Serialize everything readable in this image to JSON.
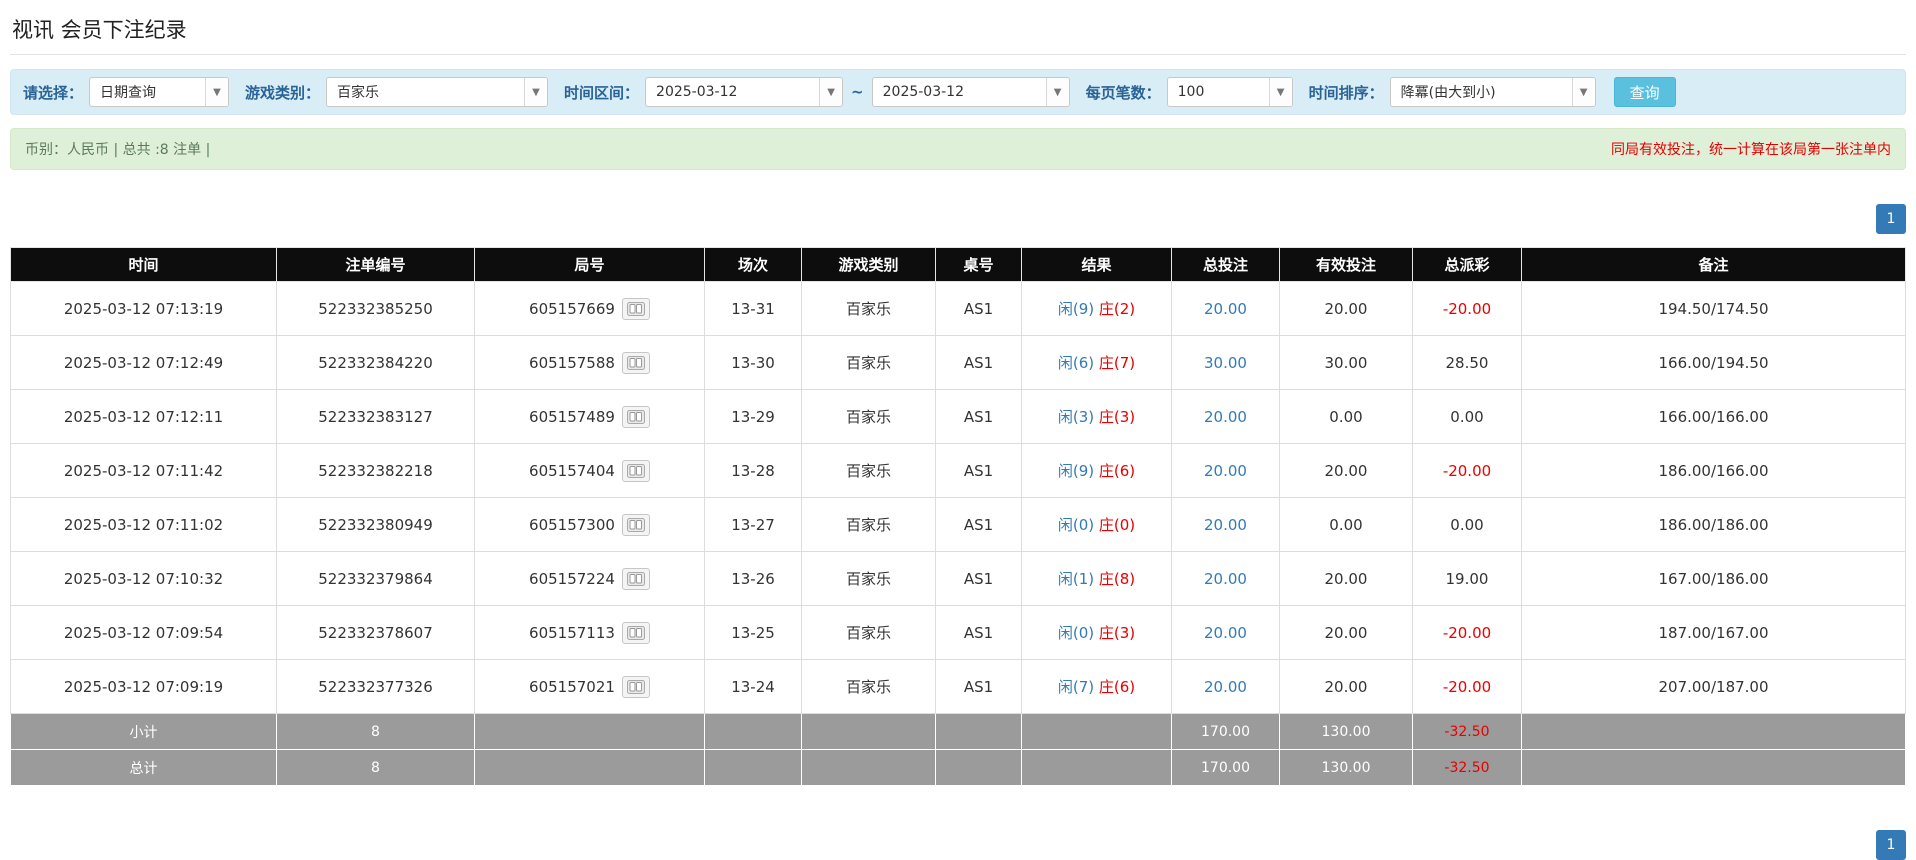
{
  "page": {
    "title": "视讯 会员下注纪录"
  },
  "colors": {
    "accent_blue": "#337ab7",
    "danger_red": "#e60000",
    "filter_bar_bg": "#d9edf7",
    "summary_bar_bg": "#dff0d8",
    "table_header_bg": "#0d0d0d",
    "summary_row_bg": "#9b9b9b",
    "search_button_bg": "#5bc0de"
  },
  "filters": {
    "select_label": "请选择：",
    "select_value": "日期查询",
    "game_type_label": "游戏类别：",
    "game_type_value": "百家乐",
    "date_range_label": "时间区间：",
    "date_from": "2025-03-12",
    "tilde": "~",
    "date_to": "2025-03-12",
    "page_size_label": "每页笔数：",
    "page_size_value": "100",
    "sort_label": "时间排序：",
    "sort_value": "降冪(由大到小)",
    "search_button": "查询",
    "caret": "▼"
  },
  "summary": {
    "left": "币别：人民币 | 总共 :8 注单 |",
    "right": "同局有效投注，统一计算在该局第一张注单内"
  },
  "pagination": {
    "current_page": "1"
  },
  "table": {
    "headers": [
      "时间",
      "注单编号",
      "局号",
      "场次",
      "游戏类别",
      "桌号",
      "结果",
      "总投注",
      "有效投注",
      "总派彩",
      "备注"
    ],
    "rows": [
      {
        "time": "2025-03-12 07:13:19",
        "bet_id": "522332385250",
        "round": "605157669",
        "session": "13-31",
        "game": "百家乐",
        "table_no": "AS1",
        "result_player": "闲(9)",
        "result_banker": "庄(2)",
        "total_bet": "20.00",
        "valid_bet": "20.00",
        "payout": "-20.00",
        "note": "194.50/174.50"
      },
      {
        "time": "2025-03-12 07:12:49",
        "bet_id": "522332384220",
        "round": "605157588",
        "session": "13-30",
        "game": "百家乐",
        "table_no": "AS1",
        "result_player": "闲(6)",
        "result_banker": "庄(7)",
        "total_bet": "30.00",
        "valid_bet": "30.00",
        "payout": "28.50",
        "note": "166.00/194.50"
      },
      {
        "time": "2025-03-12 07:12:11",
        "bet_id": "522332383127",
        "round": "605157489",
        "session": "13-29",
        "game": "百家乐",
        "table_no": "AS1",
        "result_player": "闲(3)",
        "result_banker": "庄(3)",
        "total_bet": "20.00",
        "valid_bet": "0.00",
        "payout": "0.00",
        "note": "166.00/166.00"
      },
      {
        "time": "2025-03-12 07:11:42",
        "bet_id": "522332382218",
        "round": "605157404",
        "session": "13-28",
        "game": "百家乐",
        "table_no": "AS1",
        "result_player": "闲(9)",
        "result_banker": "庄(6)",
        "total_bet": "20.00",
        "valid_bet": "20.00",
        "payout": "-20.00",
        "note": "186.00/166.00"
      },
      {
        "time": "2025-03-12 07:11:02",
        "bet_id": "522332380949",
        "round": "605157300",
        "session": "13-27",
        "game": "百家乐",
        "table_no": "AS1",
        "result_player": "闲(0)",
        "result_banker": "庄(0)",
        "total_bet": "20.00",
        "valid_bet": "0.00",
        "payout": "0.00",
        "note": "186.00/186.00"
      },
      {
        "time": "2025-03-12 07:10:32",
        "bet_id": "522332379864",
        "round": "605157224",
        "session": "13-26",
        "game": "百家乐",
        "table_no": "AS1",
        "result_player": "闲(1)",
        "result_banker": "庄(8)",
        "total_bet": "20.00",
        "valid_bet": "20.00",
        "payout": "19.00",
        "note": "167.00/186.00"
      },
      {
        "time": "2025-03-12 07:09:54",
        "bet_id": "522332378607",
        "round": "605157113",
        "session": "13-25",
        "game": "百家乐",
        "table_no": "AS1",
        "result_player": "闲(0)",
        "result_banker": "庄(3)",
        "total_bet": "20.00",
        "valid_bet": "20.00",
        "payout": "-20.00",
        "note": "187.00/167.00"
      },
      {
        "time": "2025-03-12 07:09:19",
        "bet_id": "522332377326",
        "round": "605157021",
        "session": "13-24",
        "game": "百家乐",
        "table_no": "AS1",
        "result_player": "闲(7)",
        "result_banker": "庄(6)",
        "total_bet": "20.00",
        "valid_bet": "20.00",
        "payout": "-20.00",
        "note": "207.00/187.00"
      }
    ],
    "subtotal": {
      "label": "小计",
      "count": "8",
      "total_bet": "170.00",
      "valid_bet": "130.00",
      "payout": "-32.50"
    },
    "total": {
      "label": "总计",
      "count": "8",
      "total_bet": "170.00",
      "valid_bet": "130.00",
      "payout": "-32.50"
    }
  }
}
